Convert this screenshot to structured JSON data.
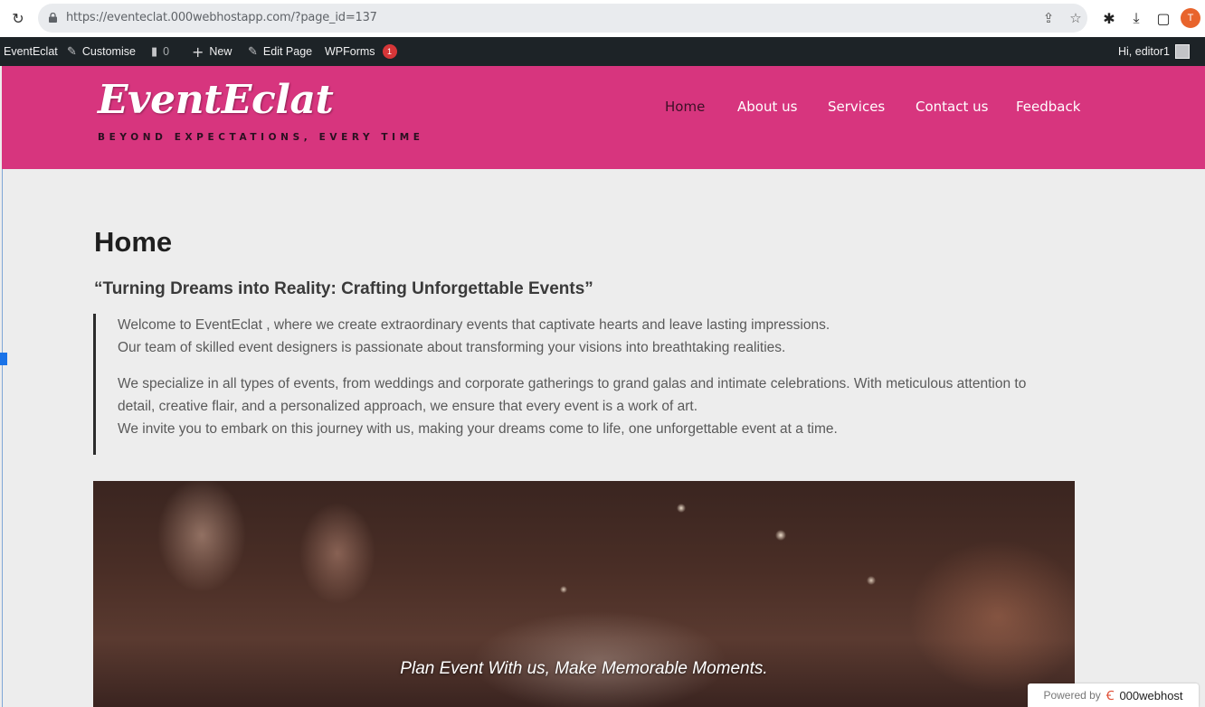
{
  "browser": {
    "url": "https://eventeclat.000webhostapp.com/?page_id=137",
    "profile_initial": "T"
  },
  "adminbar": {
    "site": "EventEclat",
    "customise": "Customise",
    "comments_count": "0",
    "new": "New",
    "edit_page": "Edit Page",
    "wpforms": "WPForms",
    "wpforms_badge": "1",
    "greeting": "Hi, editor1"
  },
  "site": {
    "logo": "EventEclat",
    "tagline": "BEYOND EXPECTATIONS, EVERY TIME",
    "nav": [
      "Home",
      "About us",
      "Services",
      "Contact us",
      "Feedback"
    ],
    "active_nav": "Home"
  },
  "page": {
    "title": "Home",
    "subtitle": "“Turning Dreams into Reality: Crafting Unforgettable Events”",
    "quote_lines": [
      "Welcome to EventEclat , where we create extraordinary events that captivate hearts and leave lasting impressions.",
      "Our team of skilled event designers is passionate about transforming your visions into breathtaking realities.",
      "We specialize in all types of events, from weddings and corporate gatherings to grand galas and intimate celebrations. With meticulous attention to",
      "detail, creative flair, and a personalized approach, we ensure that every event is a work of art.",
      "We invite you to embark on this journey with us, making your dreams come to life, one unforgettable event at a time."
    ],
    "hero_caption": "Plan Event With us, Make Memorable Moments."
  },
  "footer_badge": {
    "powered_by": "Powered by",
    "brand": "000webhost"
  }
}
